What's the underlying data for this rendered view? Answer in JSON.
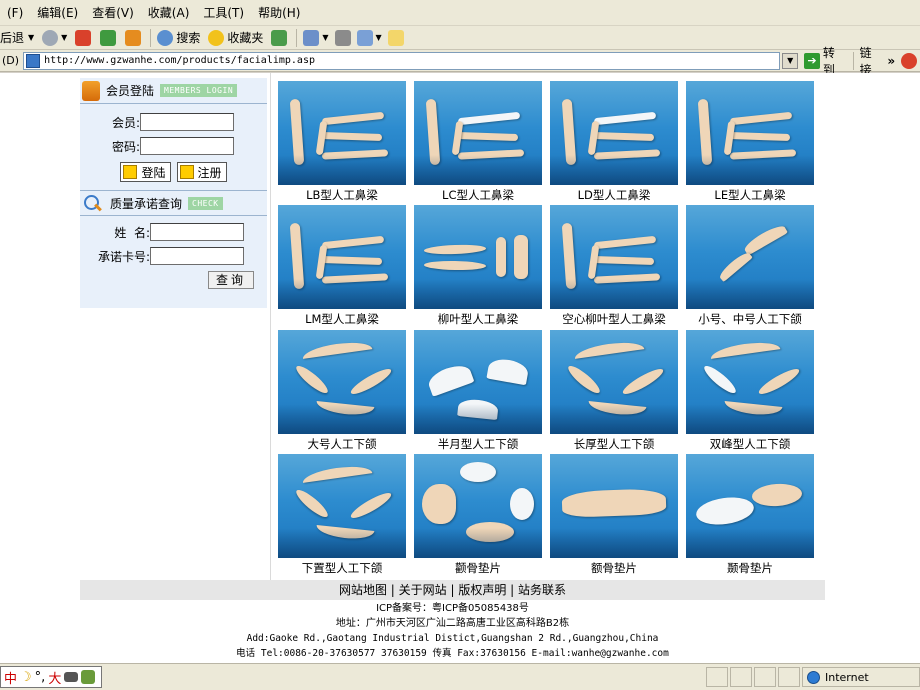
{
  "menubar": {
    "items": [
      "(F)",
      "编辑(E)",
      "查看(V)",
      "收藏(A)",
      "工具(T)",
      "帮助(H)"
    ]
  },
  "toolbar": {
    "back_label": "后退",
    "search_label": "搜索",
    "favorites_label": "收藏夹"
  },
  "addressbar": {
    "label": "(D)",
    "url": "http://www.gzwanhe.com/products/facialimp.asp",
    "go_label": "转到",
    "links_label": "链接",
    "more_label": "»"
  },
  "login": {
    "title": "会员登陆",
    "tag": "MEMBERS LOGIN",
    "member_label": "会员:",
    "password_label": "密码:",
    "member_value": "",
    "password_value": "",
    "login_button": "登陆",
    "register_button": "注册"
  },
  "query": {
    "title": "质量承诺查询",
    "tag": "CHECK",
    "name_label": "姓  名:",
    "card_label": "承诺卡号:",
    "name_value": "",
    "card_value": "",
    "query_button": "查询"
  },
  "products": [
    {
      "name": "LB型人工鼻梁",
      "kind": "nose",
      "variant": 0
    },
    {
      "name": "LC型人工鼻梁",
      "kind": "nose",
      "variant": 1
    },
    {
      "name": "LD型人工鼻梁",
      "kind": "nose",
      "variant": 2
    },
    {
      "name": "LE型人工鼻梁",
      "kind": "nose",
      "variant": 3
    },
    {
      "name": "LM型人工鼻梁",
      "kind": "nose",
      "variant": 4
    },
    {
      "name": "柳叶型人工鼻梁",
      "kind": "willow",
      "variant": 0
    },
    {
      "name": "空心柳叶型人工鼻梁",
      "kind": "nose",
      "variant": 5
    },
    {
      "name": "小号、中号人工下颌",
      "kind": "chin-small",
      "variant": 0
    },
    {
      "name": "大号人工下颌",
      "kind": "chin",
      "variant": 0
    },
    {
      "name": "半月型人工下颌",
      "kind": "halfmoon",
      "variant": 0
    },
    {
      "name": "长厚型人工下颌",
      "kind": "chin",
      "variant": 1
    },
    {
      "name": "双峰型人工下颌",
      "kind": "chin",
      "variant": 2
    },
    {
      "name": "下置型人工下颌",
      "kind": "chin",
      "variant": 3
    },
    {
      "name": "颧骨垫片",
      "kind": "cheek",
      "variant": 0
    },
    {
      "name": "额骨垫片",
      "kind": "forehead",
      "variant": 0
    },
    {
      "name": "颞骨垫片",
      "kind": "temple",
      "variant": 0
    }
  ],
  "footer": {
    "nav": "网站地图 | 关于网站 | 版权声明 | 站务联系",
    "icp": "ICP备案号：粤ICP备05085438号",
    "address_cn": "地址：广州市天河区广汕二路高唐工业区高科路B2栋",
    "address_en": "Add:Gaoke Rd.,Gaotang Industrial Distict,Guangshan 2 Rd.,Guangzhou,China",
    "contact": "电话 Tel:0086-20-37630577 37630159 传真 Fax:37630156 E-mail:wanhe@gzwanhe.com"
  },
  "statusbar": {
    "ime": [
      "中",
      "☽",
      "°,",
      "大"
    ],
    "zone": "Internet"
  },
  "colors": {
    "thumb_blue": "#2d8ccf",
    "implant": "#efd6b8",
    "sidebar_bg": "#e8f0fa",
    "tag_green": "#9ed5a4"
  }
}
